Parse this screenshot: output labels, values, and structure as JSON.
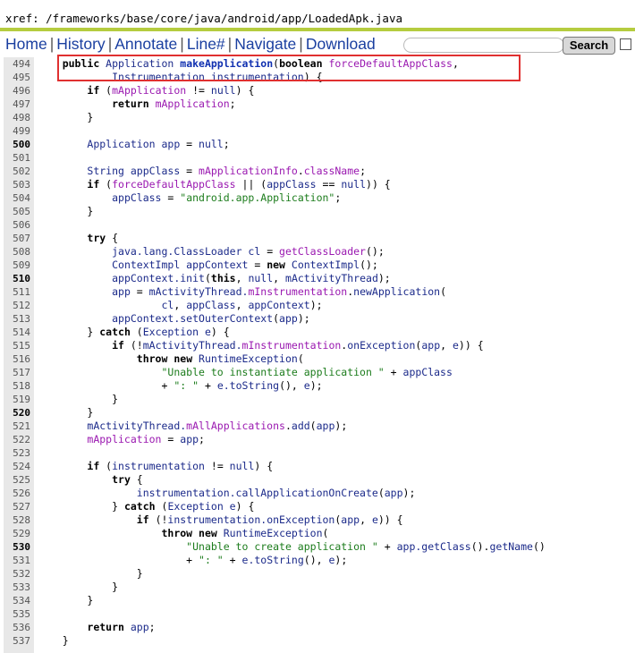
{
  "xref": "xref: /frameworks/base/core/java/android/app/LoadedApk.java",
  "nav": {
    "home": "Home",
    "history": "History",
    "annotate": "Annotate",
    "line": "Line#",
    "navigate": "Navigate",
    "download": "Download",
    "separator": "|"
  },
  "search": {
    "value": "",
    "button_label": "Search"
  },
  "colors": {
    "keyword": "#000000",
    "member": "#9a18b0",
    "method": "#1030b0",
    "identifier": "#1b2a8a",
    "string": "#1c7c1c",
    "rule": "#b5cc3f",
    "highlight": "#e03030"
  },
  "code_lines": [
    {
      "num": "494",
      "hl": false,
      "tokens": [
        {
          "t": "    "
        },
        {
          "t": "public",
          "c": "kw"
        },
        {
          "t": " Application ",
          "c": "nm"
        },
        {
          "t": "makeApplication",
          "c": "fn"
        },
        {
          "t": "(",
          "c": "pl"
        },
        {
          "t": "boolean",
          "c": "kw"
        },
        {
          "t": " ",
          "c": "pl"
        },
        {
          "t": "forceDefaultAppClass",
          "c": "mem"
        },
        {
          "t": ",",
          "c": "pl"
        }
      ]
    },
    {
      "num": "495",
      "hl": false,
      "tokens": [
        {
          "t": "            "
        },
        {
          "t": "Instrumentation instrumentation",
          "c": "nm"
        },
        {
          "t": ") {",
          "c": "pl"
        }
      ]
    },
    {
      "num": "496",
      "hl": false,
      "tokens": [
        {
          "t": "        "
        },
        {
          "t": "if",
          "c": "kw"
        },
        {
          "t": " (",
          "c": "pl"
        },
        {
          "t": "mApplication",
          "c": "mem"
        },
        {
          "t": " != ",
          "c": "pl"
        },
        {
          "t": "null",
          "c": "nm"
        },
        {
          "t": ") {",
          "c": "pl"
        }
      ]
    },
    {
      "num": "497",
      "hl": false,
      "tokens": [
        {
          "t": "            "
        },
        {
          "t": "return",
          "c": "kw"
        },
        {
          "t": " ",
          "c": "pl"
        },
        {
          "t": "mApplication",
          "c": "mem"
        },
        {
          "t": ";",
          "c": "pl"
        }
      ]
    },
    {
      "num": "498",
      "hl": false,
      "tokens": [
        {
          "t": "        "
        },
        {
          "t": "}",
          "c": "pl"
        }
      ]
    },
    {
      "num": "499",
      "hl": false,
      "tokens": []
    },
    {
      "num": "500",
      "hl": true,
      "tokens": [
        {
          "t": "        "
        },
        {
          "t": "Application app",
          "c": "nm"
        },
        {
          "t": " = ",
          "c": "pl"
        },
        {
          "t": "null",
          "c": "nm"
        },
        {
          "t": ";",
          "c": "pl"
        }
      ]
    },
    {
      "num": "501",
      "hl": false,
      "tokens": []
    },
    {
      "num": "502",
      "hl": false,
      "tokens": [
        {
          "t": "        "
        },
        {
          "t": "String appClass",
          "c": "nm"
        },
        {
          "t": " = ",
          "c": "pl"
        },
        {
          "t": "mApplicationInfo",
          "c": "mem"
        },
        {
          "t": ".",
          "c": "pl"
        },
        {
          "t": "className",
          "c": "mem"
        },
        {
          "t": ";",
          "c": "pl"
        }
      ]
    },
    {
      "num": "503",
      "hl": false,
      "tokens": [
        {
          "t": "        "
        },
        {
          "t": "if",
          "c": "kw"
        },
        {
          "t": " (",
          "c": "pl"
        },
        {
          "t": "forceDefaultAppClass",
          "c": "mem"
        },
        {
          "t": " || (",
          "c": "pl"
        },
        {
          "t": "appClass",
          "c": "nm"
        },
        {
          "t": " == ",
          "c": "pl"
        },
        {
          "t": "null",
          "c": "nm"
        },
        {
          "t": ")) {",
          "c": "pl"
        }
      ]
    },
    {
      "num": "504",
      "hl": false,
      "tokens": [
        {
          "t": "            "
        },
        {
          "t": "appClass",
          "c": "nm"
        },
        {
          "t": " = ",
          "c": "pl"
        },
        {
          "t": "\"android.app.Application\"",
          "c": "str"
        },
        {
          "t": ";",
          "c": "pl"
        }
      ]
    },
    {
      "num": "505",
      "hl": false,
      "tokens": [
        {
          "t": "        "
        },
        {
          "t": "}",
          "c": "pl"
        }
      ]
    },
    {
      "num": "506",
      "hl": false,
      "tokens": []
    },
    {
      "num": "507",
      "hl": false,
      "tokens": [
        {
          "t": "        "
        },
        {
          "t": "try",
          "c": "kw"
        },
        {
          "t": " {",
          "c": "pl"
        }
      ]
    },
    {
      "num": "508",
      "hl": false,
      "tokens": [
        {
          "t": "            "
        },
        {
          "t": "java.lang.ClassLoader cl",
          "c": "nm"
        },
        {
          "t": " = ",
          "c": "pl"
        },
        {
          "t": "getClassLoader",
          "c": "mem"
        },
        {
          "t": "();",
          "c": "pl"
        }
      ]
    },
    {
      "num": "509",
      "hl": false,
      "tokens": [
        {
          "t": "            "
        },
        {
          "t": "ContextImpl appContext",
          "c": "nm"
        },
        {
          "t": " = ",
          "c": "pl"
        },
        {
          "t": "new",
          "c": "kw"
        },
        {
          "t": " ContextImpl",
          "c": "nm"
        },
        {
          "t": "();",
          "c": "pl"
        }
      ]
    },
    {
      "num": "510",
      "hl": true,
      "tokens": [
        {
          "t": "            "
        },
        {
          "t": "appContext.init",
          "c": "nm"
        },
        {
          "t": "(",
          "c": "pl"
        },
        {
          "t": "this",
          "c": "kw"
        },
        {
          "t": ", ",
          "c": "pl"
        },
        {
          "t": "null",
          "c": "nm"
        },
        {
          "t": ", ",
          "c": "pl"
        },
        {
          "t": "mActivityThread",
          "c": "nm"
        },
        {
          "t": ");",
          "c": "pl"
        }
      ]
    },
    {
      "num": "511",
      "hl": false,
      "tokens": [
        {
          "t": "            "
        },
        {
          "t": "app",
          "c": "nm"
        },
        {
          "t": " = ",
          "c": "pl"
        },
        {
          "t": "mActivityThread.",
          "c": "nm"
        },
        {
          "t": "mInstrumentation",
          "c": "mem"
        },
        {
          "t": ".",
          "c": "pl"
        },
        {
          "t": "newApplication",
          "c": "nm"
        },
        {
          "t": "(",
          "c": "pl"
        }
      ]
    },
    {
      "num": "512",
      "hl": false,
      "tokens": [
        {
          "t": "                    "
        },
        {
          "t": "cl",
          "c": "nm"
        },
        {
          "t": ", ",
          "c": "pl"
        },
        {
          "t": "appClass",
          "c": "nm"
        },
        {
          "t": ", ",
          "c": "pl"
        },
        {
          "t": "appContext",
          "c": "nm"
        },
        {
          "t": ");",
          "c": "pl"
        }
      ]
    },
    {
      "num": "513",
      "hl": false,
      "tokens": [
        {
          "t": "            "
        },
        {
          "t": "appContext.setOuterContext",
          "c": "nm"
        },
        {
          "t": "(",
          "c": "pl"
        },
        {
          "t": "app",
          "c": "nm"
        },
        {
          "t": ");",
          "c": "pl"
        }
      ]
    },
    {
      "num": "514",
      "hl": false,
      "tokens": [
        {
          "t": "        "
        },
        {
          "t": "} ",
          "c": "pl"
        },
        {
          "t": "catch",
          "c": "kw"
        },
        {
          "t": " (",
          "c": "pl"
        },
        {
          "t": "Exception e",
          "c": "nm"
        },
        {
          "t": ") {",
          "c": "pl"
        }
      ]
    },
    {
      "num": "515",
      "hl": false,
      "tokens": [
        {
          "t": "            "
        },
        {
          "t": "if",
          "c": "kw"
        },
        {
          "t": " (!",
          "c": "pl"
        },
        {
          "t": "mActivityThread.",
          "c": "nm"
        },
        {
          "t": "mInstrumentation",
          "c": "mem"
        },
        {
          "t": ".",
          "c": "pl"
        },
        {
          "t": "onException",
          "c": "nm"
        },
        {
          "t": "(",
          "c": "pl"
        },
        {
          "t": "app",
          "c": "nm"
        },
        {
          "t": ", ",
          "c": "pl"
        },
        {
          "t": "e",
          "c": "nm"
        },
        {
          "t": ")) {",
          "c": "pl"
        }
      ]
    },
    {
      "num": "516",
      "hl": false,
      "tokens": [
        {
          "t": "                "
        },
        {
          "t": "throw",
          "c": "kw"
        },
        {
          "t": " ",
          "c": "pl"
        },
        {
          "t": "new",
          "c": "kw"
        },
        {
          "t": " RuntimeException",
          "c": "nm"
        },
        {
          "t": "(",
          "c": "pl"
        }
      ]
    },
    {
      "num": "517",
      "hl": false,
      "tokens": [
        {
          "t": "                    "
        },
        {
          "t": "\"Unable to instantiate application \"",
          "c": "str"
        },
        {
          "t": " + ",
          "c": "pl"
        },
        {
          "t": "appClass",
          "c": "nm"
        }
      ]
    },
    {
      "num": "518",
      "hl": false,
      "tokens": [
        {
          "t": "                    "
        },
        {
          "t": "+ ",
          "c": "pl"
        },
        {
          "t": "\": \"",
          "c": "str"
        },
        {
          "t": " + ",
          "c": "pl"
        },
        {
          "t": "e.toString",
          "c": "nm"
        },
        {
          "t": "(), ",
          "c": "pl"
        },
        {
          "t": "e",
          "c": "nm"
        },
        {
          "t": ");",
          "c": "pl"
        }
      ]
    },
    {
      "num": "519",
      "hl": false,
      "tokens": [
        {
          "t": "            "
        },
        {
          "t": "}",
          "c": "pl"
        }
      ]
    },
    {
      "num": "520",
      "hl": true,
      "tokens": [
        {
          "t": "        "
        },
        {
          "t": "}",
          "c": "pl"
        }
      ]
    },
    {
      "num": "521",
      "hl": false,
      "tokens": [
        {
          "t": "        "
        },
        {
          "t": "mActivityThread.",
          "c": "nm"
        },
        {
          "t": "mAllApplications",
          "c": "mem"
        },
        {
          "t": ".",
          "c": "pl"
        },
        {
          "t": "add",
          "c": "nm"
        },
        {
          "t": "(",
          "c": "pl"
        },
        {
          "t": "app",
          "c": "nm"
        },
        {
          "t": ");",
          "c": "pl"
        }
      ]
    },
    {
      "num": "522",
      "hl": false,
      "tokens": [
        {
          "t": "        "
        },
        {
          "t": "mApplication",
          "c": "mem"
        },
        {
          "t": " = ",
          "c": "pl"
        },
        {
          "t": "app",
          "c": "nm"
        },
        {
          "t": ";",
          "c": "pl"
        }
      ]
    },
    {
      "num": "523",
      "hl": false,
      "tokens": []
    },
    {
      "num": "524",
      "hl": false,
      "tokens": [
        {
          "t": "        "
        },
        {
          "t": "if",
          "c": "kw"
        },
        {
          "t": " (",
          "c": "pl"
        },
        {
          "t": "instrumentation",
          "c": "nm"
        },
        {
          "t": " != ",
          "c": "pl"
        },
        {
          "t": "null",
          "c": "nm"
        },
        {
          "t": ") {",
          "c": "pl"
        }
      ]
    },
    {
      "num": "525",
      "hl": false,
      "tokens": [
        {
          "t": "            "
        },
        {
          "t": "try",
          "c": "kw"
        },
        {
          "t": " {",
          "c": "pl"
        }
      ]
    },
    {
      "num": "526",
      "hl": false,
      "tokens": [
        {
          "t": "                "
        },
        {
          "t": "instrumentation.callApplicationOnCreate",
          "c": "nm"
        },
        {
          "t": "(",
          "c": "pl"
        },
        {
          "t": "app",
          "c": "nm"
        },
        {
          "t": ");",
          "c": "pl"
        }
      ]
    },
    {
      "num": "527",
      "hl": false,
      "tokens": [
        {
          "t": "            "
        },
        {
          "t": "} ",
          "c": "pl"
        },
        {
          "t": "catch",
          "c": "kw"
        },
        {
          "t": " (",
          "c": "pl"
        },
        {
          "t": "Exception e",
          "c": "nm"
        },
        {
          "t": ") {",
          "c": "pl"
        }
      ]
    },
    {
      "num": "528",
      "hl": false,
      "tokens": [
        {
          "t": "                "
        },
        {
          "t": "if",
          "c": "kw"
        },
        {
          "t": " (!",
          "c": "pl"
        },
        {
          "t": "instrumentation.onException",
          "c": "nm"
        },
        {
          "t": "(",
          "c": "pl"
        },
        {
          "t": "app",
          "c": "nm"
        },
        {
          "t": ", ",
          "c": "pl"
        },
        {
          "t": "e",
          "c": "nm"
        },
        {
          "t": ")) {",
          "c": "pl"
        }
      ]
    },
    {
      "num": "529",
      "hl": false,
      "tokens": [
        {
          "t": "                    "
        },
        {
          "t": "throw",
          "c": "kw"
        },
        {
          "t": " ",
          "c": "pl"
        },
        {
          "t": "new",
          "c": "kw"
        },
        {
          "t": " RuntimeException",
          "c": "nm"
        },
        {
          "t": "(",
          "c": "pl"
        }
      ]
    },
    {
      "num": "530",
      "hl": true,
      "tokens": [
        {
          "t": "                        "
        },
        {
          "t": "\"Unable to create application \"",
          "c": "str"
        },
        {
          "t": " + ",
          "c": "pl"
        },
        {
          "t": "app.getClass",
          "c": "nm"
        },
        {
          "t": "().",
          "c": "pl"
        },
        {
          "t": "getName",
          "c": "nm"
        },
        {
          "t": "()",
          "c": "pl"
        }
      ]
    },
    {
      "num": "531",
      "hl": false,
      "tokens": [
        {
          "t": "                        "
        },
        {
          "t": "+ ",
          "c": "pl"
        },
        {
          "t": "\": \"",
          "c": "str"
        },
        {
          "t": " + ",
          "c": "pl"
        },
        {
          "t": "e.toString",
          "c": "nm"
        },
        {
          "t": "(), ",
          "c": "pl"
        },
        {
          "t": "e",
          "c": "nm"
        },
        {
          "t": ");",
          "c": "pl"
        }
      ]
    },
    {
      "num": "532",
      "hl": false,
      "tokens": [
        {
          "t": "                "
        },
        {
          "t": "}",
          "c": "pl"
        }
      ]
    },
    {
      "num": "533",
      "hl": false,
      "tokens": [
        {
          "t": "            "
        },
        {
          "t": "}",
          "c": "pl"
        }
      ]
    },
    {
      "num": "534",
      "hl": false,
      "tokens": [
        {
          "t": "        "
        },
        {
          "t": "}",
          "c": "pl"
        }
      ]
    },
    {
      "num": "535",
      "hl": false,
      "tokens": []
    },
    {
      "num": "536",
      "hl": false,
      "tokens": [
        {
          "t": "        "
        },
        {
          "t": "return",
          "c": "kw"
        },
        {
          "t": " ",
          "c": "pl"
        },
        {
          "t": "app",
          "c": "nm"
        },
        {
          "t": ";",
          "c": "pl"
        }
      ]
    },
    {
      "num": "537",
      "hl": false,
      "tokens": [
        {
          "t": "    "
        },
        {
          "t": "}",
          "c": "pl"
        }
      ]
    }
  ]
}
